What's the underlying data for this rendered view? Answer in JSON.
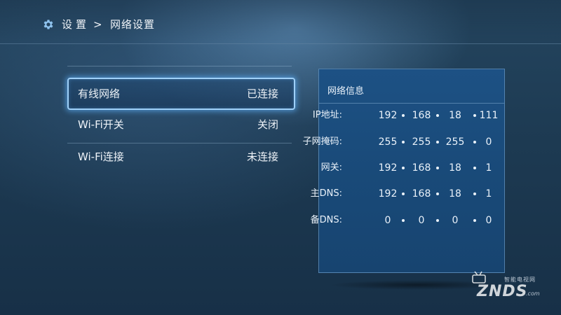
{
  "breadcrumb": {
    "root": "设置",
    "separator": ">",
    "current": "网络设置",
    "icon": "gear-icon"
  },
  "menu": {
    "items": [
      {
        "label": "有线网络",
        "value": "已连接",
        "selected": true
      },
      {
        "label": "Wi-Fi开关",
        "value": "关闭",
        "selected": false
      },
      {
        "label": "Wi-Fi连接",
        "value": "未连接",
        "selected": false
      }
    ]
  },
  "network_info": {
    "title": "网络信息",
    "rows": [
      {
        "label": "IP地址",
        "octets": [
          "192",
          "168",
          "18",
          "111"
        ]
      },
      {
        "label": "子网掩码",
        "octets": [
          "255",
          "255",
          "255",
          "0"
        ]
      },
      {
        "label": "网关",
        "octets": [
          "192",
          "168",
          "18",
          "1"
        ]
      },
      {
        "label": "主DNS",
        "octets": [
          "192",
          "168",
          "18",
          "1"
        ]
      },
      {
        "label": "备DNS",
        "octets": [
          "0",
          "0",
          "0",
          "0"
        ]
      }
    ]
  },
  "watermark": {
    "tagline": "智能电视网",
    "brand": "ZNDS",
    "suffix": ".com"
  },
  "colors": {
    "background": "#1d3a52",
    "panel": "#1a4b7b",
    "focus_border": "#9fd0f8"
  }
}
